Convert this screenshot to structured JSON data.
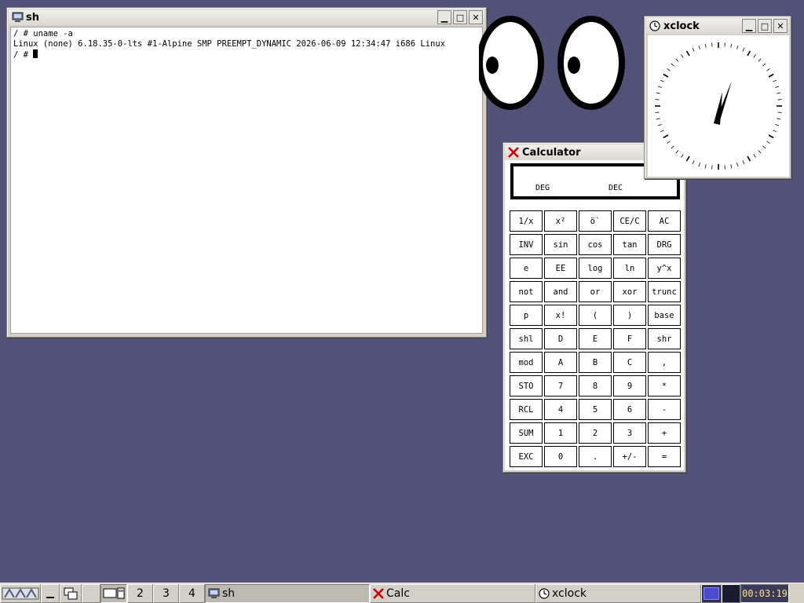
{
  "terminal": {
    "title": "sh",
    "lines": [
      "/ # uname -a",
      "Linux (none) 6.18.35-0-lts #1-Alpine SMP PREEMPT_DYNAMIC 2026-06-09 12:34:47 i686 Linux",
      "/ # "
    ]
  },
  "calculator": {
    "title": "Calculator",
    "display": {
      "angle_mode": "DEG",
      "base_mode": "DEC"
    },
    "keys": [
      "1/x",
      "x²",
      "ö`",
      "CE/C",
      "AC",
      "INV",
      "sin",
      "cos",
      "tan",
      "DRG",
      "e",
      "EE",
      "log",
      "ln",
      "y^x",
      "not",
      "and",
      "or",
      "xor",
      "trunc",
      "p",
      "x!",
      "(",
      ")",
      "base",
      "shl",
      "D",
      "E",
      "F",
      "shr",
      "mod",
      "A",
      "B",
      "C",
      ",",
      "STO",
      "7",
      "8",
      "9",
      "*",
      "RCL",
      "4",
      "5",
      "6",
      "-",
      "SUM",
      "1",
      "2",
      "3",
      "+",
      "EXC",
      "0",
      ".",
      "+/-",
      "="
    ]
  },
  "xclock": {
    "title": "xclock"
  },
  "taskbar": {
    "workspaces": [
      "2",
      "3",
      "4"
    ],
    "tasks": [
      {
        "label": "sh",
        "icon": "terminal-icon"
      },
      {
        "label": "Calc",
        "icon": "x-icon"
      },
      {
        "label": "xclock",
        "icon": "clock-icon"
      }
    ],
    "clock": "00:03:19"
  },
  "window_buttons": {
    "minimize": "▁",
    "maximize": "□",
    "close": "✕"
  },
  "colors": {
    "desktop": "#525278",
    "x_red": "#cc0000"
  }
}
